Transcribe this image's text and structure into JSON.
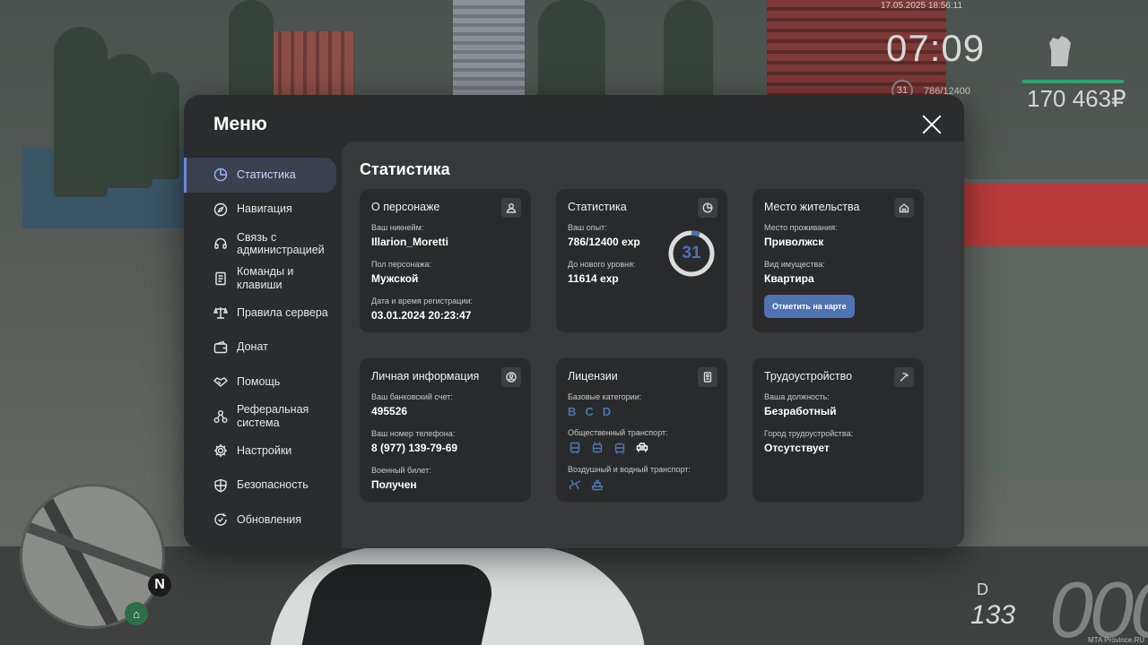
{
  "hud": {
    "datetime": "17.05.2025 18:56:11",
    "clock": "07:09",
    "level": "31",
    "exp": "786/12400",
    "money": "170 463₽",
    "gear": "D",
    "fuel": "133",
    "speed": "000",
    "compass": "N",
    "watermark": "MTA Province.RU"
  },
  "menu": {
    "title": "Меню",
    "sidebar": [
      {
        "label": "Статистика",
        "icon": "pie-icon",
        "active": true
      },
      {
        "label": "Навигация",
        "icon": "compass-icon"
      },
      {
        "label": "Связь с администрацией",
        "icon": "headset-icon"
      },
      {
        "label": "Команды и клавиши",
        "icon": "document-icon"
      },
      {
        "label": "Правила сервера",
        "icon": "scales-icon"
      },
      {
        "label": "Донат",
        "icon": "wallet-icon"
      },
      {
        "label": "Помощь",
        "icon": "handshake-icon"
      },
      {
        "label": "Реферальная система",
        "icon": "network-icon"
      },
      {
        "label": "Настройки",
        "icon": "gear-icon"
      },
      {
        "label": "Безопасность",
        "icon": "shield-icon"
      },
      {
        "label": "Обновления",
        "icon": "refresh-icon"
      }
    ],
    "content_title": "Статистика",
    "character": {
      "title": "О персонаже",
      "nick_label": "Ваш никнейм:",
      "nick": "Illarion_Moretti",
      "gender_label": "Пол персонажа:",
      "gender": "Мужской",
      "reg_label": "Дата и время регистрации:",
      "reg": "03.01.2024 20:23:47"
    },
    "stats": {
      "title": "Статистика",
      "exp_label": "Ваш опыт:",
      "exp": "786/12400 exp",
      "next_label": "До нового уровня:",
      "next": "11614 exp",
      "level": "31",
      "progress": 0.0634,
      "ring_color": "#4f73b3"
    },
    "residence": {
      "title": "Место жительства",
      "place_label": "Место проживания:",
      "place": "Приволжск",
      "property_label": "Вид имущества:",
      "property": "Квартира",
      "map_button": "Отметить на карте"
    },
    "personal": {
      "title": "Личная информация",
      "bank_label": "Ваш банковский счет:",
      "bank": "495526",
      "phone_label": "Ваш номер телефона:",
      "phone": "8 (977) 139-79-69",
      "military_label": "Военный билет:",
      "military": "Получен"
    },
    "licenses": {
      "title": "Лицензии",
      "basic_label": "Базовые категории:",
      "categories": [
        "B",
        "C",
        "D"
      ],
      "public_label": "Общественный транспорт:",
      "public_icons": [
        "bus-icon",
        "trolleybus-icon",
        "tram-icon",
        "taxi-icon"
      ],
      "air_label": "Воздушный и водный транспорт:",
      "air_icons": [
        "plane-icon",
        "boat-icon"
      ]
    },
    "employment": {
      "title": "Трудоустройство",
      "position_label": "Ваша должность:",
      "position": "Безработный",
      "city_label": "Город трудоустройства:",
      "city": "Отсутствует"
    }
  }
}
